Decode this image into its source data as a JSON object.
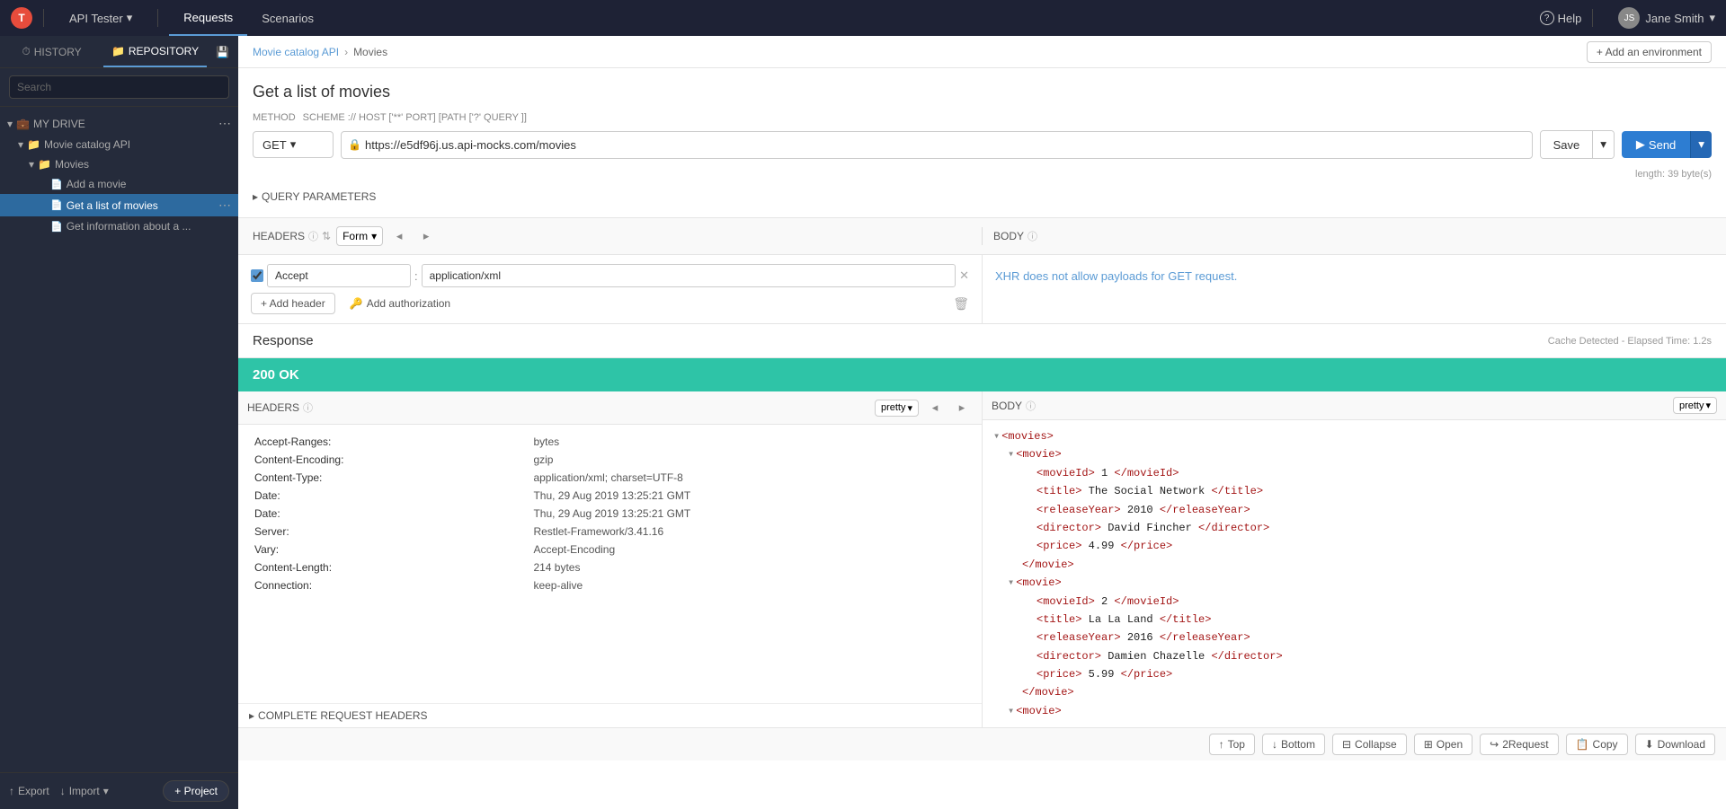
{
  "app": {
    "logo_text": "T",
    "logo_bg": "#e74c3c"
  },
  "nav": {
    "app_name": "API Tester",
    "tabs": [
      {
        "id": "requests",
        "label": "Requests",
        "active": true
      },
      {
        "id": "scenarios",
        "label": "Scenarios",
        "active": false
      }
    ],
    "help": "Help",
    "user": "Jane Smith"
  },
  "sidebar": {
    "tabs": [
      {
        "id": "history",
        "label": "HISTORY",
        "active": false,
        "icon": "⏱"
      },
      {
        "id": "repository",
        "label": "REPOSITORY",
        "active": true,
        "icon": "📁"
      },
      {
        "id": "save",
        "icon": "💾"
      }
    ],
    "search_placeholder": "Search",
    "tree": {
      "section_label": "MY DRIVE",
      "items": [
        {
          "id": "movie-catalog-api",
          "label": "Movie catalog API",
          "type": "folder",
          "indent": 0
        },
        {
          "id": "movies",
          "label": "Movies",
          "type": "folder",
          "indent": 1
        },
        {
          "id": "add-a-movie",
          "label": "Add a movie",
          "type": "file",
          "indent": 2
        },
        {
          "id": "get-a-list-of-movies",
          "label": "Get a list of movies",
          "type": "file",
          "indent": 2,
          "active": true
        },
        {
          "id": "get-information",
          "label": "Get information about a ...",
          "type": "file",
          "indent": 2
        }
      ]
    },
    "export_label": "Export",
    "import_label": "Import",
    "add_project_label": "+ Project"
  },
  "content": {
    "breadcrumb": {
      "parent": "Movie catalog API",
      "child": "Movies"
    },
    "add_env_label": "+ Add an environment"
  },
  "request": {
    "title": "Get a list of movies",
    "method_label": "METHOD",
    "scheme_label": "SCHEME :// HOST ['**' PORT] [PATH ['?' QUERY ]]",
    "method": "GET",
    "url": "https://e5df96j.us.api-mocks.com/movies",
    "save_label": "Save",
    "send_label": "Send",
    "byte_info": "length: 39 byte(s)",
    "query_params_label": "QUERY PARAMETERS",
    "headers_label": "HEADERS",
    "body_label": "BODY",
    "form_select_label": "Form",
    "header_rows": [
      {
        "enabled": true,
        "key": "Accept",
        "value": "application/xml"
      }
    ],
    "add_header_label": "+ Add header",
    "add_auth_label": "Add authorization",
    "xhr_note": "XHR does not allow payloads for GET request.",
    "xhr_highlight": "XHR"
  },
  "response": {
    "title": "Response",
    "cache_info": "Cache Detected - Elapsed Time: 1.2s",
    "status_code": "200",
    "status_text": "OK",
    "headers_label": "HEADERS",
    "body_label": "BODY",
    "pretty_label": "pretty",
    "headers": [
      {
        "key": "Accept-Ranges:",
        "value": "bytes"
      },
      {
        "key": "Content-Encoding:",
        "value": "gzip"
      },
      {
        "key": "Content-Type:",
        "value": "application/xml; charset=UTF-8"
      },
      {
        "key": "Date:",
        "value": "Thu, 29 Aug 2019 13:25:21 GMT"
      },
      {
        "key": "Date:",
        "value": "Thu, 29 Aug 2019 13:25:21 GMT"
      },
      {
        "key": "Server:",
        "value": "Restlet-Framework/3.41.16"
      },
      {
        "key": "Vary:",
        "value": "Accept-Encoding"
      },
      {
        "key": "Content-Length:",
        "value": "214 bytes"
      },
      {
        "key": "Connection:",
        "value": "keep-alive"
      }
    ],
    "complete_req_headers_label": "COMPLETE REQUEST HEADERS",
    "xml_body": "<movies>\n  <movie>\n    <movieId> 1 </movieId>\n    <title> The Social Network </title>\n    <releaseYear> 2010 </releaseYear>\n    <director> David Fincher </director>\n    <price> 4.99 </price>\n  </movie>\n  <movie>\n    <movieId> 2 </movieId>\n    <title> La La Land </title>\n    <releaseYear> 2016 </releaseYear>\n    <director> Damien Chazelle </director>\n    <price> 5.99 </price>\n  </movie>\n  <movie>",
    "toolbar": {
      "top_label": "Top",
      "bottom_label": "Bottom",
      "collapse_label": "Collapse",
      "open_label": "Open",
      "to_request_label": "2Request",
      "copy_label": "Copy",
      "download_label": "Download"
    }
  }
}
